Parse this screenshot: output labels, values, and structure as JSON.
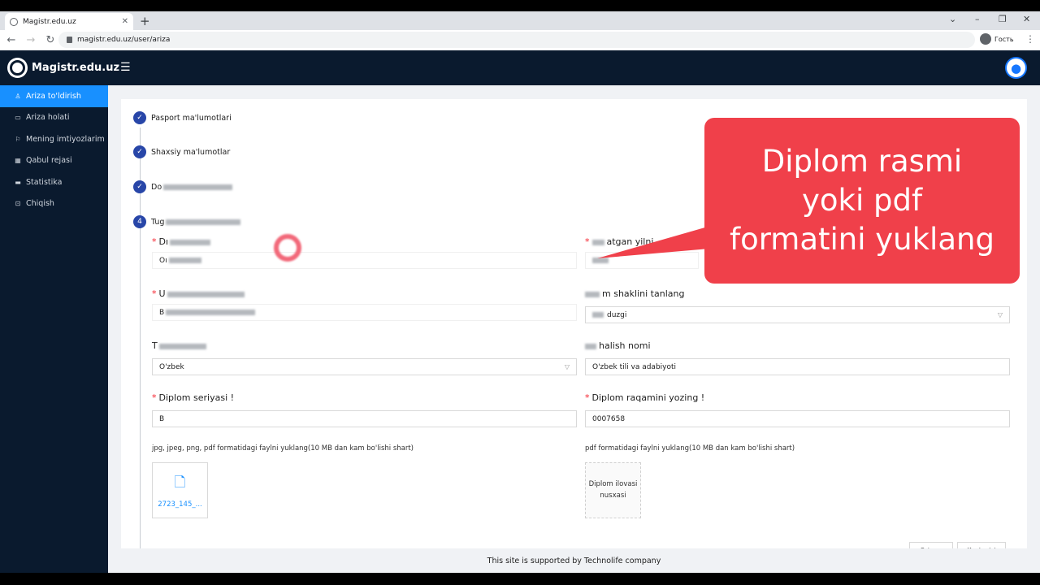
{
  "browser": {
    "tab_title": "Magistr.edu.uz",
    "url": "magistr.edu.uz/user/ariza",
    "profile_label": "Гость"
  },
  "app": {
    "logo_text": "Magistr.edu.uz"
  },
  "sidebar": {
    "items": [
      {
        "label": "Ariza to'ldirish",
        "icon": "user-icon"
      },
      {
        "label": "Ariza holati",
        "icon": "card-icon"
      },
      {
        "label": "Mening imtiyozlarim",
        "icon": "flag-icon"
      },
      {
        "label": "Qabul rejasi",
        "icon": "calendar-icon"
      },
      {
        "label": "Statistika",
        "icon": "chart-icon"
      },
      {
        "label": "Chiqish",
        "icon": "exit-icon"
      }
    ]
  },
  "steps": [
    {
      "label": "Pasport ma'lumotlari",
      "marker": "✓"
    },
    {
      "label": "Shaxsiy ma'lumotlar",
      "marker": "✓"
    },
    {
      "label": "Do",
      "marker": "✓"
    },
    {
      "label": "Tug",
      "marker": "4"
    }
  ],
  "form": {
    "f1_label": "Dı",
    "f1_value": "Oı",
    "f2_label": "atgan yilni",
    "f3_label": "U",
    "f3_value": "B",
    "f4_label": "m shaklini tanlang",
    "f4_value": "duzgi",
    "f5_label": "T",
    "f5_value": "O'zbek",
    "f6_label": "halish nomi",
    "f6_value": "O'zbek tili va adabiyoti",
    "f7_label": "Diplom seriyasi !",
    "f7_value": "B",
    "f8_label": "Diplom raqamini yozing !",
    "f8_value": "0007658",
    "upload1_hint": "jpg, jpeg, png, pdf formatidagi faylni yuklang(10 MB dan kam bo'lishi shart)",
    "upload1_filename": "2723_145_...",
    "upload2_hint": "pdf formatidagi faylni yuklang(10 MB dan kam bo'lishi shart)",
    "upload2_text": "Diplom ilovasi\nnusxasi",
    "btn_back": "Ortaga",
    "btn_next": "Keyingisi"
  },
  "footer_text": "This site is supported by Technolife company",
  "callout_text": "Diplom rasmi\nyoki pdf\nformatini yuklang",
  "colors": {
    "header_bg": "#0a1a2e",
    "active": "#1890ff",
    "step_dot": "#2846a8",
    "callout": "#f0404a"
  }
}
